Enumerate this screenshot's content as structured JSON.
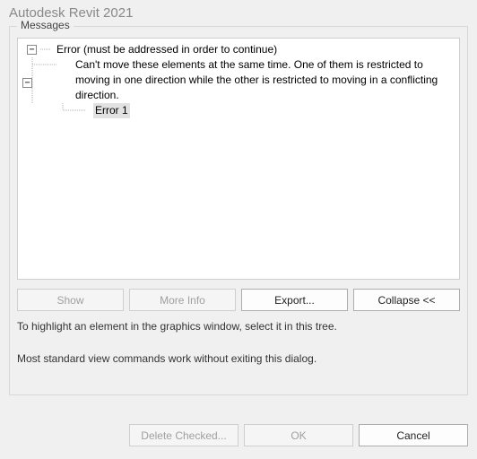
{
  "title": "Autodesk Revit 2021",
  "messages": {
    "group_label": "Messages",
    "tree": {
      "root": {
        "label": "Error (must be addressed in order to continue)",
        "children": [
          {
            "label": "Can't move these elements at the same time. One of them is restricted to moving in one direction while the other is restricted to moving in a conflicting direction.",
            "children": [
              {
                "label": "Error 1",
                "selected": true
              }
            ]
          }
        ]
      }
    },
    "buttons": {
      "show": "Show",
      "more_info": "More Info",
      "export": "Export...",
      "collapse": "Collapse <<"
    },
    "hint1": "To highlight an element in the graphics window, select it in this tree.",
    "hint2": "Most standard view commands work without exiting this dialog."
  },
  "bottom": {
    "delete_checked": "Delete Checked...",
    "ok": "OK",
    "cancel": "Cancel"
  }
}
